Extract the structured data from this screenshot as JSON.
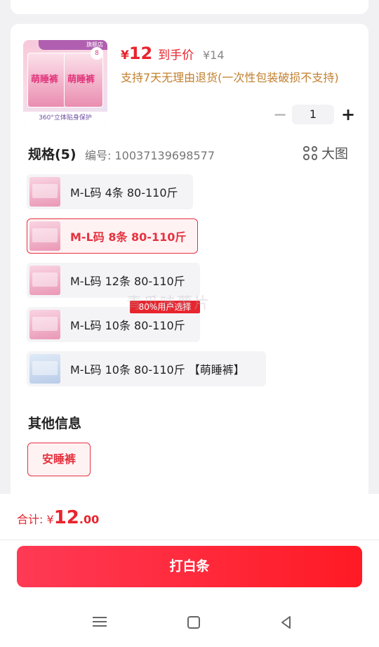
{
  "product": {
    "thumb_tag": "旗舰店",
    "thumb_brand": "萌睡裤",
    "thumb_count": "8",
    "thumb_strip": "360°立体贴身保护",
    "price_symbol": "¥",
    "price": "12",
    "price_label": "到手价",
    "original_price": "¥14",
    "policy": "支持7天无理由退货(一次性包装破损不支持)"
  },
  "quantity": {
    "minus": "−",
    "value": "1",
    "plus": "+"
  },
  "spec": {
    "title": "规格(5)",
    "code": "编号: 10037139698577",
    "big_image_label": "大图",
    "options": [
      {
        "label": "M-L码 4条 80-110斤",
        "selected": false
      },
      {
        "label": "M-L码 8条 80-110斤",
        "selected": true
      },
      {
        "label": "M-L码 12条 80-110斤",
        "selected": false
      },
      {
        "label": "M-L码 10条 80-110斤",
        "selected": false
      },
      {
        "label": "M-L码 10条 80-110斤 【萌睡裤】",
        "selected": false
      }
    ],
    "hot_badge": "80%用户选择",
    "watermark": "青瓜味薯片"
  },
  "other": {
    "title": "其他信息",
    "chip": "安睡裤"
  },
  "footer": {
    "total_label": "合计:",
    "total_symbol": "¥",
    "total_int": "12",
    "total_dec": ".00",
    "pay_button": "打白条"
  },
  "colors": {
    "accent": "#e8242d",
    "policy": "#c2802f"
  }
}
